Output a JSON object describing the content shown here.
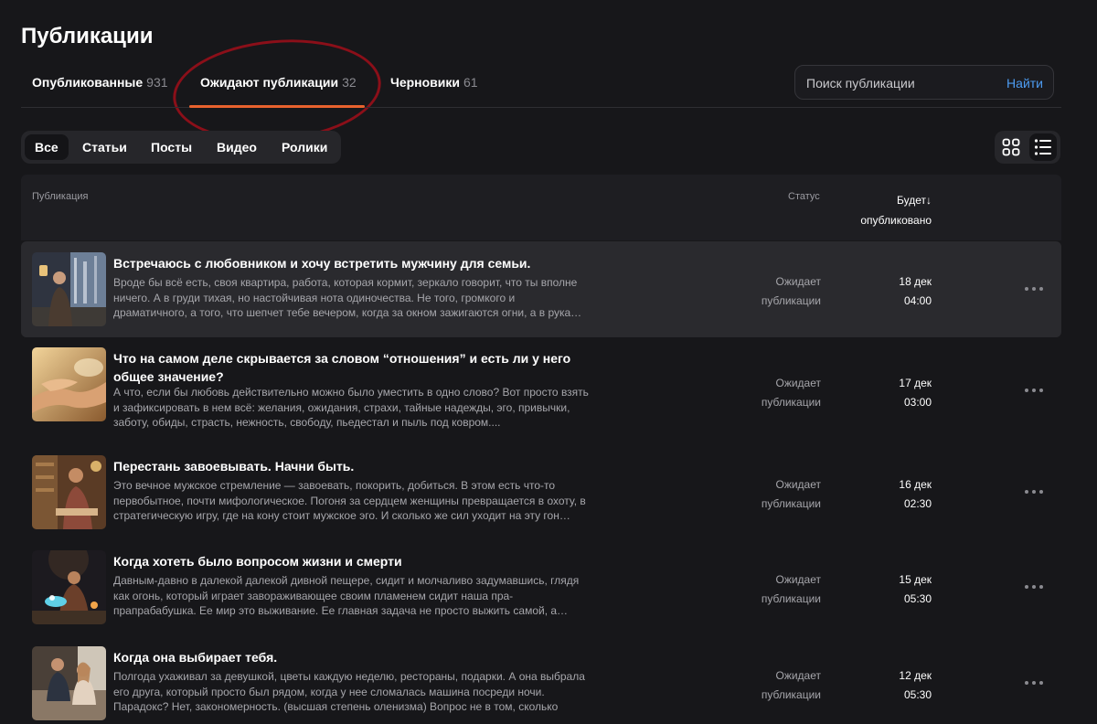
{
  "page": {
    "title": "Публикации"
  },
  "tabs": [
    {
      "label": "Опубликованные",
      "count": "931"
    },
    {
      "label": "Ожидают публикации",
      "count": "32"
    },
    {
      "label": "Черновики",
      "count": "61"
    }
  ],
  "search": {
    "placeholder": "Поиск публикации",
    "button_label": "Найти"
  },
  "filters": [
    "Все",
    "Статьи",
    "Посты",
    "Видео",
    "Ролики"
  ],
  "active_filter": "Все",
  "view_modes": {
    "grid_icon": "grid-icon",
    "list_icon": "list-icon",
    "active": "list"
  },
  "table": {
    "headers": {
      "publication": "Публикация",
      "status": "Статус",
      "date": "Будет↓ опубликовано"
    }
  },
  "rows": [
    {
      "title": "Встречаюсь с любовником и хочу встретить мужчину для семьи.",
      "snippet": "Вроде бы всё есть, своя квартира, работа, которая кормит, зеркало говорит, что ты вполне ничего. А в груди тихая, но настойчивая нота одиночества. Не того, громкого и драматичного, а того, что шепчет тебе вечером, когда за окном зажигаются огни, а в рука…",
      "status_line1": "Ожидает",
      "status_line2": "публикации",
      "date": "18 дек",
      "time": "04:00"
    },
    {
      "title": "Что на самом деле скрывается за словом “отношения” и есть ли у него общее значение?",
      "snippet": "А что, если бы любовь действительно можно было уместить в одно слово? Вот просто взять и зафиксировать в нем всё: желания, ожидания, страхи, тайные надежды, эго, привычки, заботу, обиды, страсть, нежность, свободу, пьедестал и пыль под ковром....",
      "status_line1": "Ожидает",
      "status_line2": "публикации",
      "date": "17 дек",
      "time": "03:00"
    },
    {
      "title": "Перестань завоевывать. Начни быть.",
      "snippet": "Это вечное мужское стремление — завоевать, покорить, добиться. В этом есть что-то первобытное, почти мифологическое. Погоня за сердцем женщины превращается в охоту, в стратегическую игру, где на кону стоит мужское эго. И сколько же сил уходит на эту гон…",
      "status_line1": "Ожидает",
      "status_line2": "публикации",
      "date": "16 дек",
      "time": "02:30"
    },
    {
      "title": "Когда хотеть было вопросом жизни и смерти",
      "snippet": "Давным-давно в далекой далекой дивной пещере, сидит и молчаливо задумавшись, глядя как огонь, который играет завораживающее своим пламенем сидит наша пра-прапрабабушка. Ее мир это выживание. Ее главная задача не просто выжить самой, а…",
      "status_line1": "Ожидает",
      "status_line2": "публикации",
      "date": "15 дек",
      "time": "05:30"
    },
    {
      "title": "Когда она выбирает тебя.",
      "snippet": "Полгода ухаживал за девушкой, цветы каждую неделю, рестораны, подарки. А она выбрала его друга, который просто был рядом, когда у нее сломалась машина посреди ночи. Парадокс? Нет, закономерность. (высшая степень оленизма) Вопрос не в том, сколько роз…",
      "status_line1": "Ожидает",
      "status_line2": "публикации",
      "date": "12 дек",
      "time": "05:30"
    }
  ],
  "row_actions_icon": "more-horizontal-icon"
}
